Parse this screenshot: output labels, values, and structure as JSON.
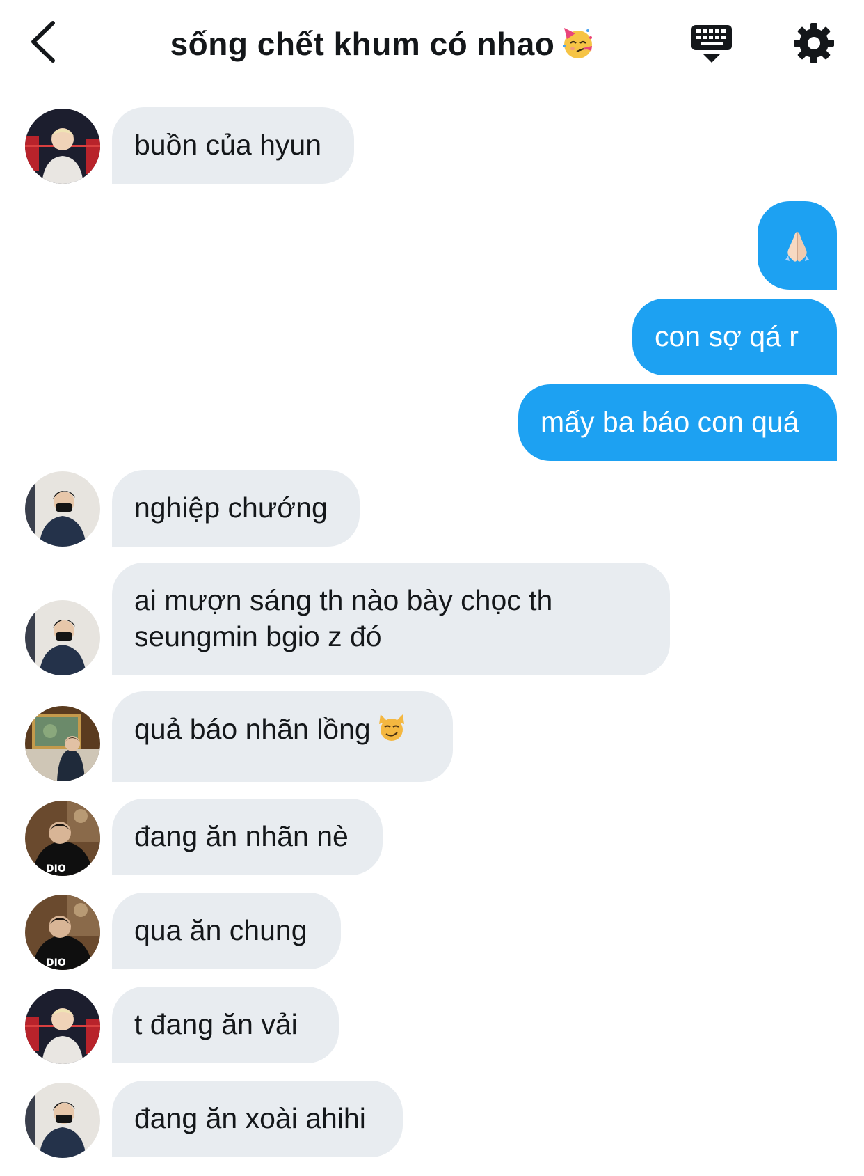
{
  "header": {
    "title": "sống chết khum có nhao",
    "title_emoji": "partying-face-emoji",
    "back_icon": "chevron-left-icon",
    "keyboard_icon": "keyboard-icon",
    "settings_icon": "gear-icon"
  },
  "messages": [
    {
      "direction": "incoming",
      "text": "buồn của hyun",
      "avatar": "avatar-1"
    },
    {
      "direction": "outgoing",
      "text": "",
      "emoji": "folded-hands-emoji"
    },
    {
      "direction": "outgoing",
      "text": "con sợ qá r"
    },
    {
      "direction": "outgoing",
      "text": "mấy ba báo con quá"
    },
    {
      "direction": "incoming",
      "text": "nghiệp chướng",
      "avatar": "avatar-2"
    },
    {
      "direction": "incoming",
      "text": "ai mượn sáng th nào bày chọc th",
      "text2": "seungmin bgio z đó",
      "avatar": "avatar-2"
    },
    {
      "direction": "incoming",
      "text": "quả báo nhãn lồng",
      "emoji": "smirking-cat-emoji",
      "avatar": "avatar-3"
    },
    {
      "direction": "incoming",
      "text": "đang ăn nhãn nè",
      "avatar": "avatar-4"
    },
    {
      "direction": "incoming",
      "text": "qua ăn chung",
      "avatar": "avatar-4"
    },
    {
      "direction": "incoming",
      "text": "t đang ăn vải",
      "avatar": "avatar-1"
    },
    {
      "direction": "incoming",
      "text": "đang ăn xoài ahihi",
      "avatar": "avatar-2"
    }
  ],
  "colors": {
    "outgoing_bubble": "#1da1f2",
    "incoming_bubble": "#e8ecf0",
    "text": "#14171a"
  }
}
